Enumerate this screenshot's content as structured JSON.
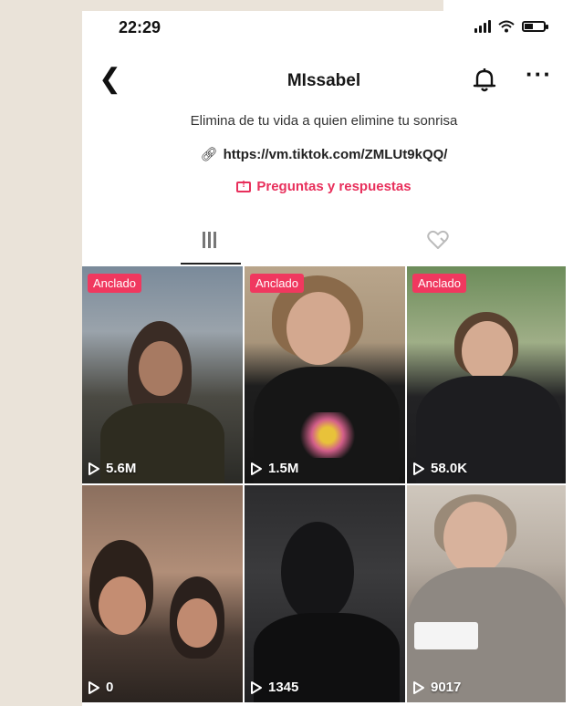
{
  "status_bar": {
    "time": "22:29"
  },
  "nav": {
    "title": "MIssabel"
  },
  "profile": {
    "bio": "Elimina de tu vida a quien elimine tu sonrisa",
    "link": "https://vm.tiktok.com/ZMLUt9kQQ/",
    "qa_label": "Preguntas y respuestas"
  },
  "tabs": [
    {
      "icon": "grid-icon",
      "active": true
    },
    {
      "icon": "liked-heart-icon",
      "active": false
    }
  ],
  "videos": [
    {
      "pinned_label": "Anclado",
      "views": "5.6M"
    },
    {
      "pinned_label": "Anclado",
      "views": "1.5M"
    },
    {
      "pinned_label": "Anclado",
      "views": "58.0K"
    },
    {
      "pinned_label": "",
      "views": "0"
    },
    {
      "pinned_label": "",
      "views": "1345"
    },
    {
      "pinned_label": "",
      "views": "9017"
    }
  ],
  "colors": {
    "accent": "#e8305c",
    "badge": "#f0385f"
  }
}
